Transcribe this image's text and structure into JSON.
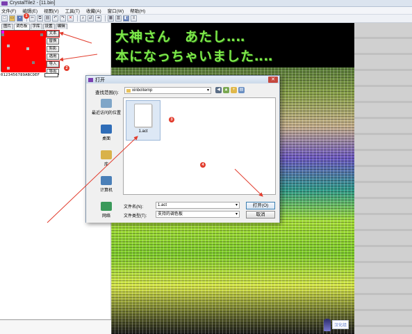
{
  "window": {
    "title": "CrystalTile2 - [11.bin]"
  },
  "menu": [
    "文件(F)",
    "编辑(E)",
    "视图(V)",
    "工具(T)",
    "收藏(A)",
    "窗口(W)",
    "帮助(H)"
  ],
  "toolbar": {
    "icons": [
      "new-icon",
      "open-icon",
      "save-icon",
      "cut-icon",
      "copy-icon",
      "paste-icon",
      "undo-icon",
      "redo-icon",
      "delete-icon",
      "find-icon",
      "replace-icon",
      "goto-icon",
      "tile-view-icon",
      "grid-icon",
      "palette-icon",
      "settings-icon"
    ]
  },
  "left_panel": {
    "tabs": [
      "图片",
      "调色板",
      "字库",
      "设置",
      "编辑"
    ],
    "buttons": [
      "文本",
      "替换",
      "剪影",
      "选用",
      "导入",
      "导出"
    ],
    "hex_labels": "0123456789ABCDEF",
    "colors": [
      "#ff0000",
      "#00ff00",
      "#0000ff",
      "#ffff00",
      "#ff00ff",
      "#00ffff",
      "#ff8000",
      "#8000ff",
      "#808080",
      "#c0c0c0",
      "#004080",
      "#408000",
      "#800040",
      "#ffffff",
      "#000000",
      "#80ff80"
    ]
  },
  "badges": {
    "one": "1",
    "two": "2",
    "three": "3",
    "four": "4"
  },
  "banner": {
    "line1": "大神さん　あたし‥‥",
    "line2": "本になっちゃいました‥‥"
  },
  "watermark": "汉化组",
  "dialog": {
    "title": "打开",
    "close_symbol": "✕",
    "look_in_label": "查找范围(I):",
    "look_in_value": "xinbo\\temp",
    "places": [
      {
        "label": "最近访问的位置",
        "icon": "recent-icon",
        "color": "#7fa6c8"
      },
      {
        "label": "桌面",
        "icon": "desktop-icon",
        "color": "#2f6db8"
      },
      {
        "label": "库",
        "icon": "library-icon",
        "color": "#d9b24a"
      },
      {
        "label": "计算机",
        "icon": "computer-icon",
        "color": "#4a7fb8"
      },
      {
        "label": "网络",
        "icon": "network-icon",
        "color": "#3a9a5a"
      }
    ],
    "file": {
      "name": "1.act"
    },
    "filename_label": "文件名(N):",
    "filename_value": "1.act",
    "filetype_label": "文件类型(T):",
    "filetype_value": "支持的调色板",
    "open_button": "打开(O)",
    "cancel_button": "取消"
  }
}
